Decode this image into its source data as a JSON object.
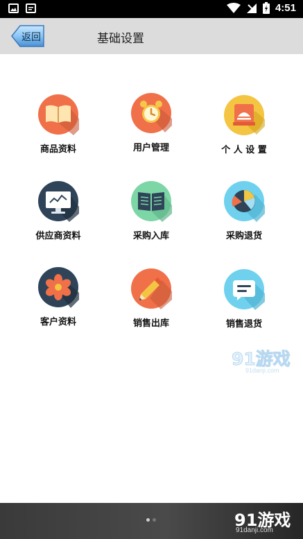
{
  "status_bar": {
    "time": "4:51"
  },
  "header": {
    "back_label": "返回",
    "title": "基础设置"
  },
  "grid": [
    {
      "label": "商品资料",
      "icon": "book-icon",
      "color": "#f07049"
    },
    {
      "label": "用户管理",
      "icon": "alarm-clock-icon",
      "color": "#f07049"
    },
    {
      "label": "个 人 设 置",
      "icon": "profile-stack-icon",
      "color": "#f4c542"
    },
    {
      "label": "供应商资料",
      "icon": "monitor-icon",
      "color": "#2f4458"
    },
    {
      "label": "采购入库",
      "icon": "open-book-icon",
      "color": "#7dd6a6"
    },
    {
      "label": "采购退货",
      "icon": "pie-chart-icon",
      "color": "#6fd1ee"
    },
    {
      "label": "客户资料",
      "icon": "flower-icon",
      "color": "#2f4458"
    },
    {
      "label": "销售出库",
      "icon": "pencil-icon",
      "color": "#f07049"
    },
    {
      "label": "销售退货",
      "icon": "message-icon",
      "color": "#6fd1ee"
    }
  ],
  "watermark": {
    "brand": "91游戏",
    "url": "91danji.com"
  },
  "bottom_bar": {
    "brand": "91游戏",
    "url": "91danji.com"
  }
}
